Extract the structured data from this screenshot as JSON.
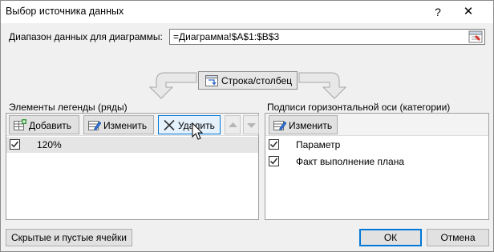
{
  "window": {
    "title": "Выбор источника данных",
    "help_glyph": "?",
    "close_glyph": "✕"
  },
  "range": {
    "label": "Диапазон данных для диаграммы:",
    "value": "=Диаграмма!$A$1:$B$3"
  },
  "switch_button": {
    "label": "Строка/столбец"
  },
  "legend_panel": {
    "title": "Элементы легенды (ряды)",
    "add_label": "Добавить",
    "edit_label": "Изменить",
    "delete_label": "Удалить",
    "items": [
      {
        "label": "120%",
        "checked": true,
        "selected": true
      }
    ]
  },
  "axis_panel": {
    "title": "Подписи горизонтальной оси (категории)",
    "edit_label": "Изменить",
    "items": [
      {
        "label": "Параметр",
        "checked": true
      },
      {
        "label": "Факт выполнение плана",
        "checked": true
      }
    ]
  },
  "footer": {
    "hidden_cells_label": "Скрытые и пустые ячейки",
    "ok_label": "ОК",
    "cancel_label": "Отмена"
  },
  "colors": {
    "accent": "#0078d7",
    "dialog_bg": "#f0f0f0",
    "selected_row": "#e5e5e5"
  }
}
